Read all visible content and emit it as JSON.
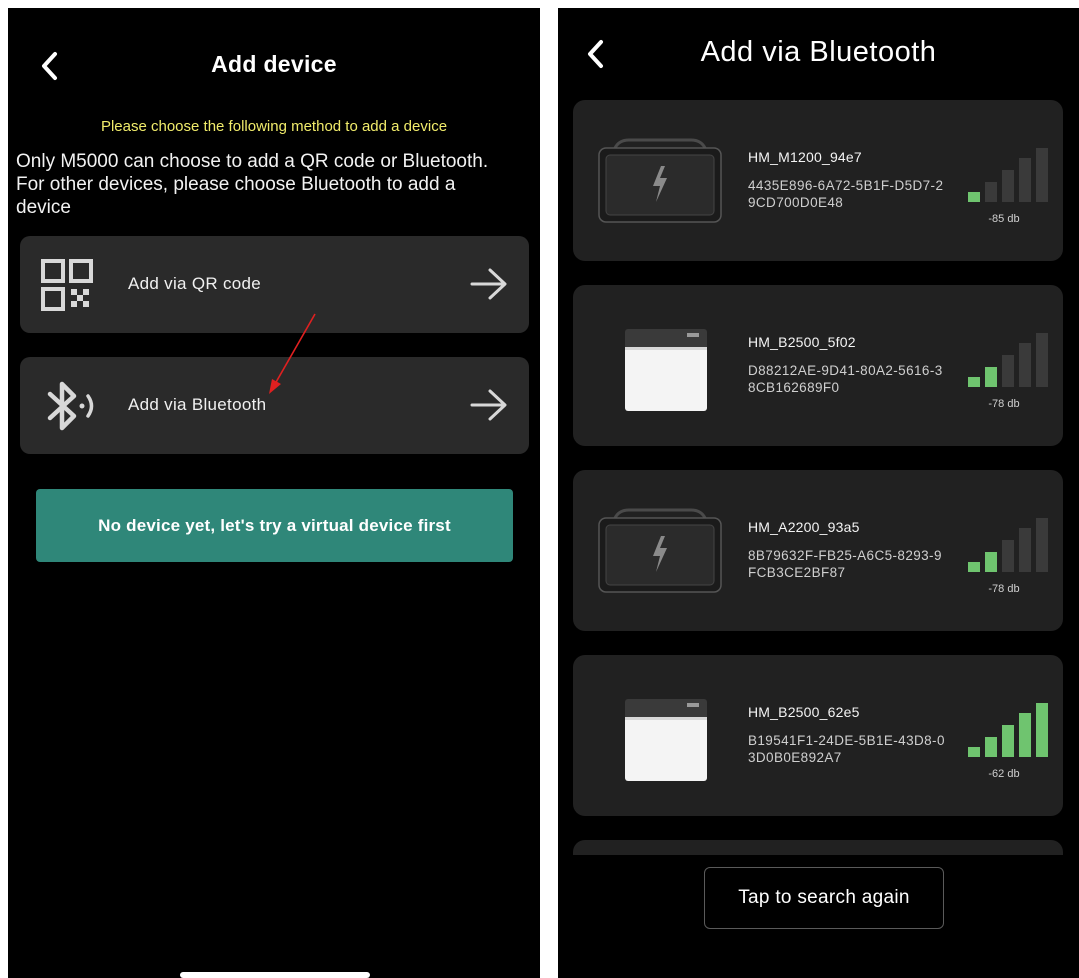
{
  "left_screen": {
    "title": "Add device",
    "hint": "Please choose the following method to add a device",
    "info": "Only M5000 can choose to add a QR code or Bluetooth. For other devices, please choose Bluetooth to add a device",
    "methods": [
      {
        "label": "Add via QR code",
        "icon": "qr-code-icon"
      },
      {
        "label": "Add via Bluetooth",
        "icon": "bluetooth-icon"
      }
    ],
    "virtual_button": "No device yet, let's try a virtual device first",
    "colors": {
      "hint": "#f1ec6b",
      "virtual_button": "#2f8779",
      "card": "#2a2a2a"
    }
  },
  "right_screen": {
    "title": "Add via Bluetooth",
    "devices": [
      {
        "name": "HM_M1200_94e7",
        "id": "4435E896-6A72-5B1F-D5D7-29CD700D0E48",
        "rssi": "-85 db",
        "signal_bars": 1,
        "image": "dark-power-station"
      },
      {
        "name": "HM_B2500_5f02",
        "id": "D88212AE-9D41-80A2-5616-38CB162689F0",
        "rssi": "-78 db",
        "signal_bars": 2,
        "image": "white-battery"
      },
      {
        "name": "HM_A2200_93a5",
        "id": "8B79632F-FB25-A6C5-8293-9FCB3CE2BF87",
        "rssi": "-78 db",
        "signal_bars": 2,
        "image": "dark-power-station"
      },
      {
        "name": "HM_B2500_62e5",
        "id": "B19541F1-24DE-5B1E-43D8-03D0B0E892A7",
        "rssi": "-62 db",
        "signal_bars": 5,
        "image": "white-battery"
      }
    ],
    "search_again": "Tap to search again",
    "colors": {
      "signal_active": "#6fc46f",
      "signal_inactive": "#3a3a3a",
      "card": "#212121"
    }
  }
}
